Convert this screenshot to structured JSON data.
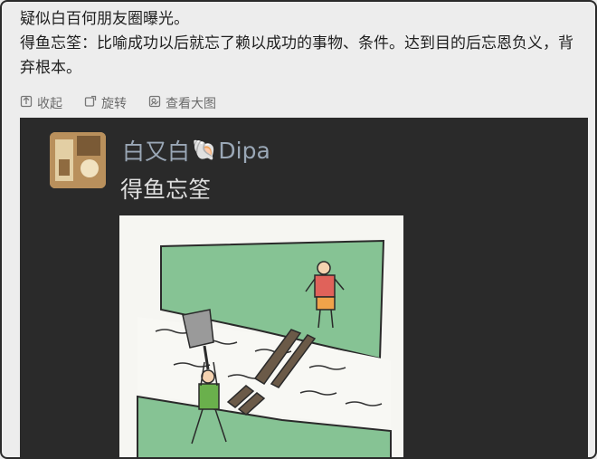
{
  "post": {
    "line1": "疑似白百何朋友圈曝光。",
    "line2": "得鱼忘筌：比喻成功以后就忘了赖以成功的事物、条件。达到目的后忘恩负义，背",
    "line3": "弃根本。"
  },
  "toolbar": {
    "collapse": "收起",
    "rotate": "旋转",
    "view_large": "查看大图",
    "collapse_icon": "collapse-icon",
    "rotate_icon": "rotate-icon",
    "view_icon": "view-large-icon"
  },
  "screenshot": {
    "username": "白又白",
    "username_suffix": "Dipa",
    "username_emoji": "🐚",
    "title": "得鱼忘筌"
  },
  "colors": {
    "page_bg": "#ededed",
    "image_bg": "#2a2a2a",
    "username_color": "#9aa7b6",
    "comic_green": "#7fbf8a",
    "figure_red": "#e0625a",
    "figure_green": "#6ab04c"
  }
}
